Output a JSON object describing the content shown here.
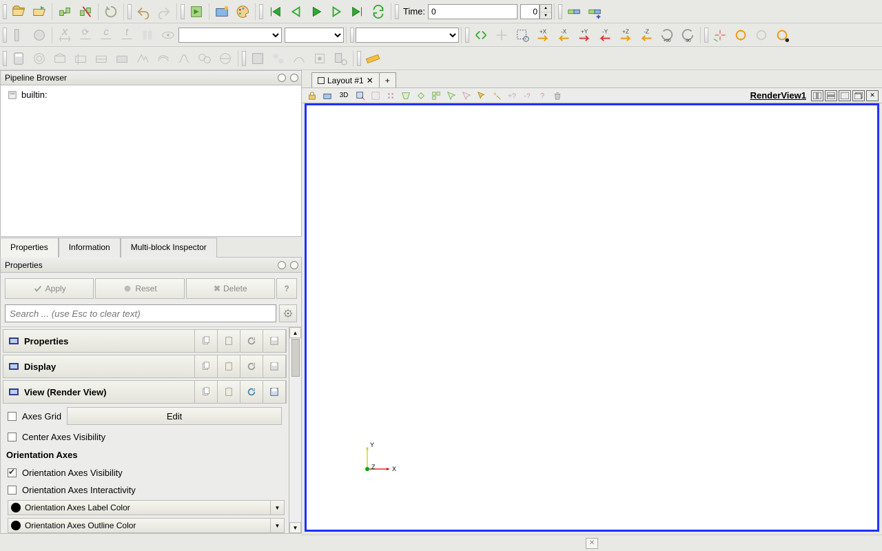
{
  "toolbar": {
    "time_label": "Time:",
    "time_value": "0",
    "time_max": "0",
    "plusx": "+X",
    "minusx": "-X",
    "plusy": "+Y",
    "minusy": "-Y",
    "plusz": "+Z",
    "minusz": "-Z",
    "rot90": "+90",
    "rotn90": "-90"
  },
  "left": {
    "pipeline_browser_title": "Pipeline Browser",
    "builtin_label": "builtin:",
    "tab_properties": "Properties",
    "tab_information": "Information",
    "tab_mbi": "Multi-block Inspector",
    "panel_properties_title": "Properties",
    "btn_apply": "Apply",
    "btn_reset": "Reset",
    "btn_delete": "Delete",
    "search_placeholder": "Search ... (use Esc to clear text)",
    "sec_properties": "Properties",
    "sec_display": "Display",
    "sec_view": "View (Render View)",
    "axes_grid": "Axes Grid",
    "edit": "Edit",
    "center_axes": "Center Axes Visibility",
    "orientation_axes": "Orientation Axes",
    "oa_visibility": "Orientation Axes Visibility",
    "oa_interact": "Orientation Axes Interactivity",
    "oa_label_color": "Orientation Axes Label Color",
    "oa_outline_color": "Orientation Axes Outline Color"
  },
  "right": {
    "layout_tab": "Layout #1",
    "view_name": "RenderView1",
    "mode_3d": "3D",
    "axis_x": "X",
    "axis_y": "Y",
    "axis_z": "Z"
  }
}
